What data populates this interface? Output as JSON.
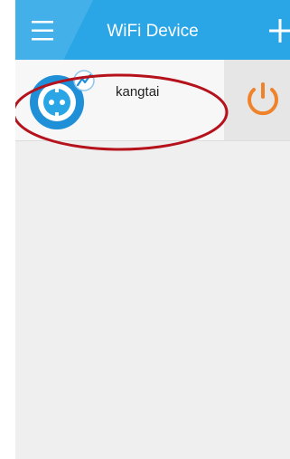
{
  "app": {
    "title": "WiFi Device"
  },
  "header": {
    "menu_icon": "hamburger-menu-icon",
    "add_icon": "plus-icon"
  },
  "devices": [
    {
      "name": "kangtai",
      "icon": "smart-plug-icon",
      "status_icon": "signal-icon",
      "power_icon": "power-icon"
    }
  ],
  "colors": {
    "header": "#2aa6e7",
    "background": "#efefef",
    "device_row": "#f7f7f7",
    "power_panel": "#e6e6e6",
    "power_accent": "#f0822a",
    "highlight_ring": "#b5121b"
  }
}
